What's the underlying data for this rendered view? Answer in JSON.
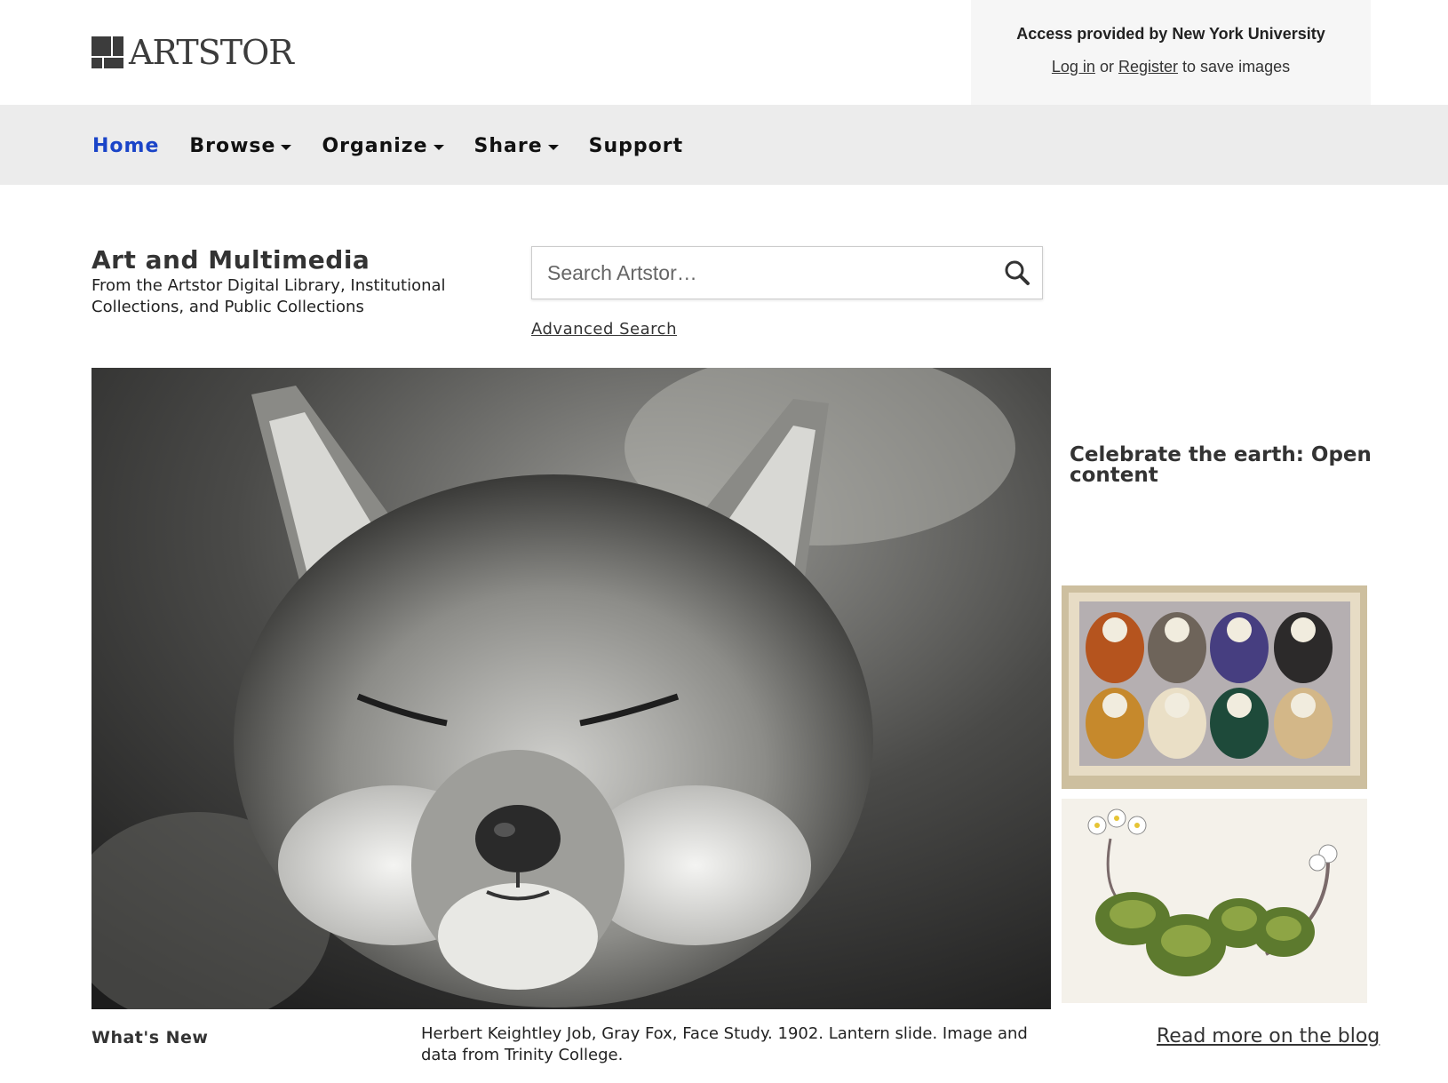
{
  "header": {
    "logo_text": "ARTSTOR",
    "access_title": "Access provided by New York University",
    "login_label": "Log in",
    "or_text": "or",
    "register_label": "Register",
    "save_text": "to save images"
  },
  "nav": {
    "home": "Home",
    "browse": "Browse",
    "organize": "Organize",
    "share": "Share",
    "support": "Support"
  },
  "main": {
    "title": "Art and Multimedia",
    "subtitle": "From the Artstor Digital Library, Institutional Collections, and Public Collections",
    "search_placeholder": "Search Artstor…",
    "advanced_search": "Advanced Search",
    "side_heading": "Celebrate the earth: Open content",
    "whats_new": "What's New",
    "caption": "Herbert Keightley Job, Gray Fox, Face Study. 1902. Lantern slide. Image and data from Trinity College.",
    "blog_link": "Read more on the blog"
  },
  "colors": {
    "nav_active": "#1a44c8",
    "nav_bg": "#ececec",
    "access_bg": "#f6f6f6"
  },
  "icons": {
    "search": "search-icon",
    "dropdown": "caret-down-icon"
  }
}
